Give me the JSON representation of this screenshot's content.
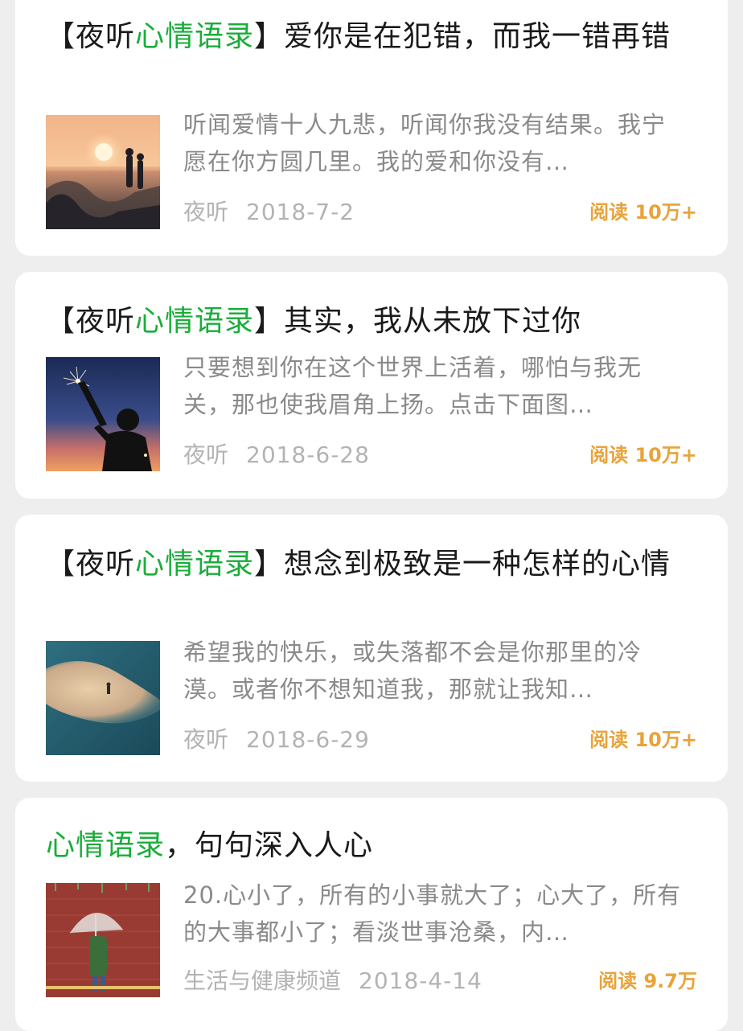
{
  "articles": [
    {
      "title_prefix": "【夜听",
      "title_highlight": "心情语录",
      "title_suffix": "】爱你是在犯错，而我一错再错",
      "summary": "听闻爱情十人九悲，听闻你我没有结果。我宁愿在你方圆几里。我的爱和你没有…",
      "author": "夜听",
      "date": "2018-7-2",
      "reads": "阅读 10万+",
      "thumb_icon": "sunset-couple-photo"
    },
    {
      "title_prefix": "【夜听",
      "title_highlight": "心情语录",
      "title_suffix": "】其实，我从未放下过你",
      "summary": "只要想到你在这个世界上活着，哪怕与我无关，那也使我眉角上扬。点击下面图…",
      "author": "夜听",
      "date": "2018-6-28",
      "reads": "阅读 10万+",
      "thumb_icon": "sparkler-silhouette-photo"
    },
    {
      "title_prefix": "【夜听",
      "title_highlight": "心情语录",
      "title_suffix": "】想念到极致是一种怎样的心情",
      "summary": "希望我的快乐，或失落都不会是你那里的冷漠。或者你不想知道我，那就让我知…",
      "author": "夜听",
      "date": "2018-6-29",
      "reads": "阅读 10万+",
      "thumb_icon": "aerial-beach-photo"
    },
    {
      "title_prefix": "",
      "title_highlight": "心情语录",
      "title_suffix": "，句句深入人心",
      "summary": "20.心小了，所有的小事就大了；心大了，所有的大事都小了；看淡世事沧桑，内…",
      "author": "生活与健康频道",
      "date": "2018-4-14",
      "reads": "阅读 9.7万",
      "thumb_icon": "umbrella-illustration"
    }
  ],
  "colors": {
    "highlight": "#1aad3a",
    "reads": "#e8a33a",
    "meta": "#b3b3b3",
    "summary": "#8a8a8a"
  }
}
